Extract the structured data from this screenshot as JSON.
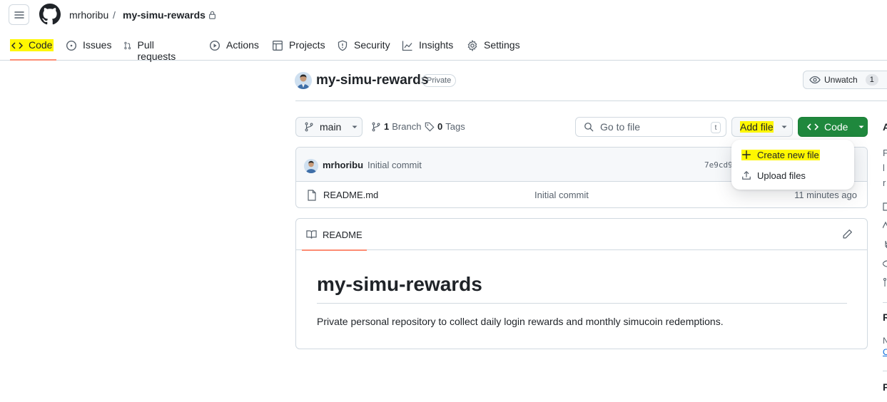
{
  "header": {
    "owner": "mrhoribu",
    "separator": "/",
    "repo": "my-simu-rewards"
  },
  "nav": {
    "tabs": [
      {
        "label": "Code",
        "icon": "code-icon",
        "active": true
      },
      {
        "label": "Issues",
        "icon": "issue-icon"
      },
      {
        "label": "Pull requests",
        "icon": "pull-request-icon"
      },
      {
        "label": "Actions",
        "icon": "play-icon"
      },
      {
        "label": "Projects",
        "icon": "table-icon"
      },
      {
        "label": "Security",
        "icon": "shield-icon"
      },
      {
        "label": "Insights",
        "icon": "graph-icon"
      },
      {
        "label": "Settings",
        "icon": "gear-icon"
      }
    ]
  },
  "repo": {
    "title": "my-simu-rewards",
    "visibility": "Private",
    "unwatch_label": "Unwatch",
    "watch_count": "1"
  },
  "toolbar": {
    "branch": "main",
    "branch_count": "1",
    "branch_label": "Branch",
    "tag_count": "0",
    "tag_label": "Tags",
    "go_to_file_placeholder": "Go to file",
    "go_to_file_shortcut": "t",
    "add_file_label": "Add file",
    "code_label": "Code"
  },
  "add_file_menu": {
    "items": [
      {
        "label": "Create new file",
        "icon": "plus-icon"
      },
      {
        "label": "Upload files",
        "icon": "upload-icon"
      }
    ]
  },
  "commit": {
    "author": "mrhoribu",
    "message": "Initial commit",
    "hash": "7e9cd9"
  },
  "files": [
    {
      "name": "README.md",
      "commit_message": "Initial commit",
      "age": "11 minutes ago"
    }
  ],
  "readme": {
    "tab_label": "README",
    "heading": "my-simu-rewards",
    "body": "Private personal repository to collect daily login rewards and monthly simucoin redemptions."
  },
  "sidebar_edge": {
    "about_initial": "A",
    "desc_line1": "P",
    "desc_line2": "l",
    "desc_line3": "r",
    "releases_initial": "R",
    "releases_sub1": "N",
    "releases_sub2": "C",
    "packages_initial": "P"
  },
  "colors": {
    "accent_underline": "#fd8c73",
    "highlight": "#fff700",
    "primary_button": "#1f883d"
  }
}
